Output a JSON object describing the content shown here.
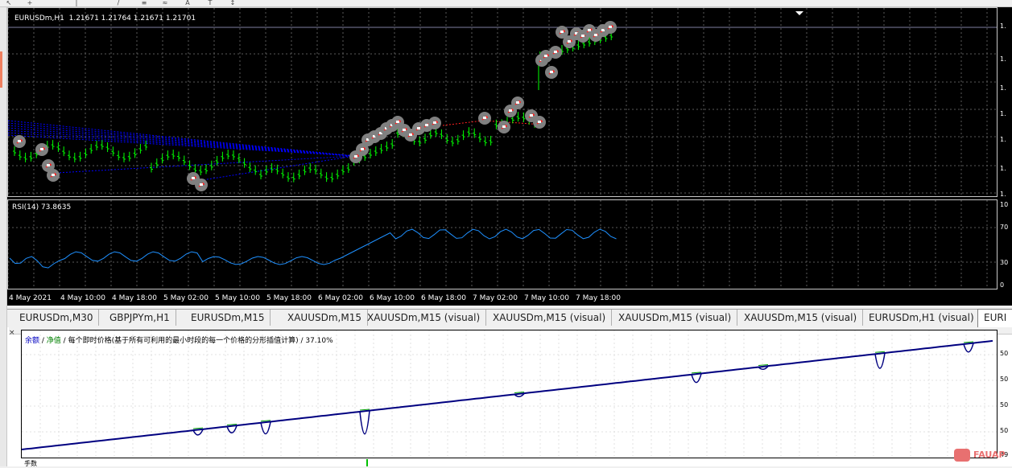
{
  "chart": {
    "info": "EURUSDm,H1  1.21671 1.21764 1.21671 1.21701",
    "price_scale": [
      "1.",
      "1.",
      "1.",
      "1.",
      "1.",
      "1.",
      "1.",
      "1."
    ],
    "time_labels": [
      "4 May 2021",
      "4 May 10:00",
      "4 May 18:00",
      "5 May 02:00",
      "5 May 10:00",
      "5 May 18:00",
      "6 May 02:00",
      "6 May 10:00",
      "6 May 18:00",
      "7 May 02:00",
      "7 May 10:00",
      "7 May 18:00"
    ],
    "rsi_info": "RSI(14) 73.8635",
    "rsi_scale": [
      "10",
      "70",
      "30",
      "0"
    ],
    "colors": {
      "bull": "#00ff00",
      "bear": "#00ff00",
      "grid": "#5a5a5a",
      "trend": "#0000ff",
      "rsi": "#1e90ff",
      "marker": "#808080",
      "trade_arrow": "#ff2020"
    }
  },
  "tabs": [
    {
      "label": "EURUSDm,M30"
    },
    {
      "label": "GBPJPYm,H1"
    },
    {
      "label": "EURUSDm,M15"
    },
    {
      "label": "XAUUSDm,M15"
    },
    {
      "label": "XAUUSDm,M15 (visual)"
    },
    {
      "label": "XAUUSDm,M15 (visual)"
    },
    {
      "label": "XAUUSDm,M15 (visual)"
    },
    {
      "label": "XAUUSDm,M15 (visual)"
    },
    {
      "label": "EURUSDm,H1 (visual)"
    },
    {
      "label": "EURI"
    }
  ],
  "tester": {
    "close_label": "×",
    "balance_label": "余额",
    "equity_label": "净值",
    "description": "/ 每个即时价格(基于所有可利用的最小时段的每一个价格的分形插值计算) / 37.10%",
    "scale": [
      "50",
      "50",
      "50",
      "50",
      "49"
    ],
    "lots_label": "手数",
    "colors": {
      "balance": "#000080",
      "equity": "#00a000"
    }
  },
  "watermark": {
    "text": "FAUAP"
  }
}
